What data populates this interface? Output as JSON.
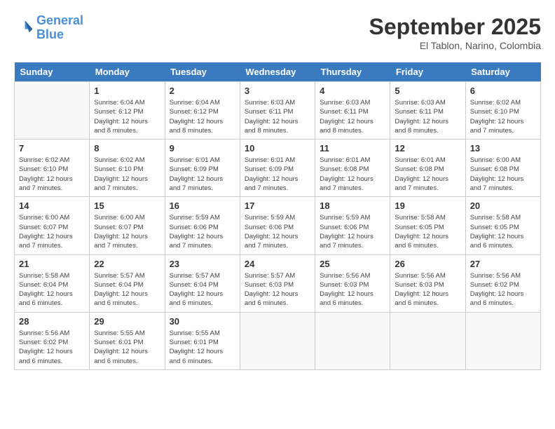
{
  "header": {
    "logo_line1": "General",
    "logo_line2": "Blue",
    "month_title": "September 2025",
    "subtitle": "El Tablon, Narino, Colombia"
  },
  "days_of_week": [
    "Sunday",
    "Monday",
    "Tuesday",
    "Wednesday",
    "Thursday",
    "Friday",
    "Saturday"
  ],
  "weeks": [
    [
      {
        "day": "",
        "sunrise": "",
        "sunset": "",
        "daylight": ""
      },
      {
        "day": "1",
        "sunrise": "Sunrise: 6:04 AM",
        "sunset": "Sunset: 6:12 PM",
        "daylight": "Daylight: 12 hours and 8 minutes."
      },
      {
        "day": "2",
        "sunrise": "Sunrise: 6:04 AM",
        "sunset": "Sunset: 6:12 PM",
        "daylight": "Daylight: 12 hours and 8 minutes."
      },
      {
        "day": "3",
        "sunrise": "Sunrise: 6:03 AM",
        "sunset": "Sunset: 6:11 PM",
        "daylight": "Daylight: 12 hours and 8 minutes."
      },
      {
        "day": "4",
        "sunrise": "Sunrise: 6:03 AM",
        "sunset": "Sunset: 6:11 PM",
        "daylight": "Daylight: 12 hours and 8 minutes."
      },
      {
        "day": "5",
        "sunrise": "Sunrise: 6:03 AM",
        "sunset": "Sunset: 6:11 PM",
        "daylight": "Daylight: 12 hours and 8 minutes."
      },
      {
        "day": "6",
        "sunrise": "Sunrise: 6:02 AM",
        "sunset": "Sunset: 6:10 PM",
        "daylight": "Daylight: 12 hours and 7 minutes."
      }
    ],
    [
      {
        "day": "7",
        "sunrise": "Sunrise: 6:02 AM",
        "sunset": "Sunset: 6:10 PM",
        "daylight": "Daylight: 12 hours and 7 minutes."
      },
      {
        "day": "8",
        "sunrise": "Sunrise: 6:02 AM",
        "sunset": "Sunset: 6:10 PM",
        "daylight": "Daylight: 12 hours and 7 minutes."
      },
      {
        "day": "9",
        "sunrise": "Sunrise: 6:01 AM",
        "sunset": "Sunset: 6:09 PM",
        "daylight": "Daylight: 12 hours and 7 minutes."
      },
      {
        "day": "10",
        "sunrise": "Sunrise: 6:01 AM",
        "sunset": "Sunset: 6:09 PM",
        "daylight": "Daylight: 12 hours and 7 minutes."
      },
      {
        "day": "11",
        "sunrise": "Sunrise: 6:01 AM",
        "sunset": "Sunset: 6:08 PM",
        "daylight": "Daylight: 12 hours and 7 minutes."
      },
      {
        "day": "12",
        "sunrise": "Sunrise: 6:01 AM",
        "sunset": "Sunset: 6:08 PM",
        "daylight": "Daylight: 12 hours and 7 minutes."
      },
      {
        "day": "13",
        "sunrise": "Sunrise: 6:00 AM",
        "sunset": "Sunset: 6:08 PM",
        "daylight": "Daylight: 12 hours and 7 minutes."
      }
    ],
    [
      {
        "day": "14",
        "sunrise": "Sunrise: 6:00 AM",
        "sunset": "Sunset: 6:07 PM",
        "daylight": "Daylight: 12 hours and 7 minutes."
      },
      {
        "day": "15",
        "sunrise": "Sunrise: 6:00 AM",
        "sunset": "Sunset: 6:07 PM",
        "daylight": "Daylight: 12 hours and 7 minutes."
      },
      {
        "day": "16",
        "sunrise": "Sunrise: 5:59 AM",
        "sunset": "Sunset: 6:06 PM",
        "daylight": "Daylight: 12 hours and 7 minutes."
      },
      {
        "day": "17",
        "sunrise": "Sunrise: 5:59 AM",
        "sunset": "Sunset: 6:06 PM",
        "daylight": "Daylight: 12 hours and 7 minutes."
      },
      {
        "day": "18",
        "sunrise": "Sunrise: 5:59 AM",
        "sunset": "Sunset: 6:06 PM",
        "daylight": "Daylight: 12 hours and 7 minutes."
      },
      {
        "day": "19",
        "sunrise": "Sunrise: 5:58 AM",
        "sunset": "Sunset: 6:05 PM",
        "daylight": "Daylight: 12 hours and 6 minutes."
      },
      {
        "day": "20",
        "sunrise": "Sunrise: 5:58 AM",
        "sunset": "Sunset: 6:05 PM",
        "daylight": "Daylight: 12 hours and 6 minutes."
      }
    ],
    [
      {
        "day": "21",
        "sunrise": "Sunrise: 5:58 AM",
        "sunset": "Sunset: 6:04 PM",
        "daylight": "Daylight: 12 hours and 6 minutes."
      },
      {
        "day": "22",
        "sunrise": "Sunrise: 5:57 AM",
        "sunset": "Sunset: 6:04 PM",
        "daylight": "Daylight: 12 hours and 6 minutes."
      },
      {
        "day": "23",
        "sunrise": "Sunrise: 5:57 AM",
        "sunset": "Sunset: 6:04 PM",
        "daylight": "Daylight: 12 hours and 6 minutes."
      },
      {
        "day": "24",
        "sunrise": "Sunrise: 5:57 AM",
        "sunset": "Sunset: 6:03 PM",
        "daylight": "Daylight: 12 hours and 6 minutes."
      },
      {
        "day": "25",
        "sunrise": "Sunrise: 5:56 AM",
        "sunset": "Sunset: 6:03 PM",
        "daylight": "Daylight: 12 hours and 6 minutes."
      },
      {
        "day": "26",
        "sunrise": "Sunrise: 5:56 AM",
        "sunset": "Sunset: 6:03 PM",
        "daylight": "Daylight: 12 hours and 6 minutes."
      },
      {
        "day": "27",
        "sunrise": "Sunrise: 5:56 AM",
        "sunset": "Sunset: 6:02 PM",
        "daylight": "Daylight: 12 hours and 6 minutes."
      }
    ],
    [
      {
        "day": "28",
        "sunrise": "Sunrise: 5:56 AM",
        "sunset": "Sunset: 6:02 PM",
        "daylight": "Daylight: 12 hours and 6 minutes."
      },
      {
        "day": "29",
        "sunrise": "Sunrise: 5:55 AM",
        "sunset": "Sunset: 6:01 PM",
        "daylight": "Daylight: 12 hours and 6 minutes."
      },
      {
        "day": "30",
        "sunrise": "Sunrise: 5:55 AM",
        "sunset": "Sunset: 6:01 PM",
        "daylight": "Daylight: 12 hours and 6 minutes."
      },
      {
        "day": "",
        "sunrise": "",
        "sunset": "",
        "daylight": ""
      },
      {
        "day": "",
        "sunrise": "",
        "sunset": "",
        "daylight": ""
      },
      {
        "day": "",
        "sunrise": "",
        "sunset": "",
        "daylight": ""
      },
      {
        "day": "",
        "sunrise": "",
        "sunset": "",
        "daylight": ""
      }
    ]
  ]
}
